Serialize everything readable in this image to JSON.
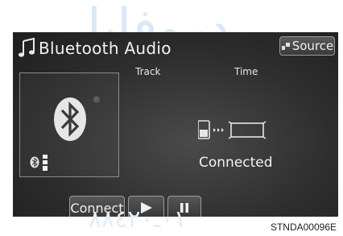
{
  "header": {
    "title": "Bluetooth Audio",
    "source_label": "Source"
  },
  "labels": {
    "track": "Track",
    "time": "Time"
  },
  "status": {
    "connection": "Connected"
  },
  "controls": {
    "connect_label": "Connect"
  },
  "icons": {
    "title": "music-note-icon",
    "source": "source-icon",
    "album_art": "bluetooth-icon",
    "device_status": "bluetooth-small-icon",
    "signal": "signal-strength-icon",
    "connection": "phone-to-car-connection-icon",
    "play": "play-icon",
    "pause": "pause-icon"
  },
  "reference_code": "STNDA00096E",
  "colors": {
    "screen": "#2e2e2e",
    "text": "#f2f2f2",
    "button_border": "#9a9a9a"
  }
}
